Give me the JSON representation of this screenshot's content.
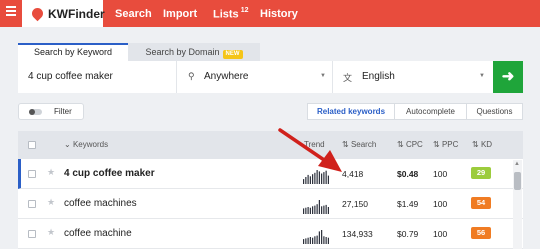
{
  "nav": {
    "brand": "KWFinder",
    "items": [
      {
        "label": "Search"
      },
      {
        "label": "Import"
      },
      {
        "label": "Lists",
        "count": "12"
      },
      {
        "label": "History"
      }
    ]
  },
  "search_tabs": {
    "active": "Search by Keyword",
    "inactive": "Search by Domain",
    "new_badge": "NEW"
  },
  "search": {
    "keyword": "4 cup coffee maker",
    "location": "Anywhere",
    "language": "English",
    "go_icon": "arrow-right-icon"
  },
  "filter": {
    "label": "Filter"
  },
  "result_tabs": [
    "Related keywords",
    "Autocomplete",
    "Questions"
  ],
  "table": {
    "headers": {
      "keywords": "Keywords",
      "trend": "Trend",
      "search": "Search",
      "cpc": "CPC",
      "ppc": "PPC",
      "kd": "KD"
    },
    "rows": [
      {
        "keyword": "4 cup coffee maker",
        "search": "4,418",
        "cpc": "$0.48",
        "ppc": "100",
        "kd": "29",
        "kd_color": "#9ccc3c",
        "trend": [
          0.35,
          0.5,
          0.65,
          0.55,
          0.7,
          0.8,
          1.0,
          0.9,
          0.75,
          0.85,
          0.95,
          0.6
        ]
      },
      {
        "keyword": "coffee machines",
        "search": "27,150",
        "cpc": "$1.49",
        "ppc": "100",
        "kd": "54",
        "kd_color": "#f07c23",
        "trend": [
          0.4,
          0.45,
          0.5,
          0.45,
          0.55,
          0.6,
          0.7,
          1.0,
          0.55,
          0.6,
          0.65,
          0.5
        ]
      },
      {
        "keyword": "coffee machine",
        "search": "134,933",
        "cpc": "$0.79",
        "ppc": "100",
        "kd": "56",
        "kd_color": "#f07c23",
        "trend": [
          0.35,
          0.4,
          0.45,
          0.5,
          0.45,
          0.55,
          0.6,
          0.9,
          1.0,
          0.55,
          0.5,
          0.45
        ]
      }
    ]
  },
  "colors": {
    "brand_red": "#e84c3d",
    "accent_blue": "#2b5fc7",
    "go_green": "#1fa53a",
    "annotation_arrow": "#d0211c"
  }
}
